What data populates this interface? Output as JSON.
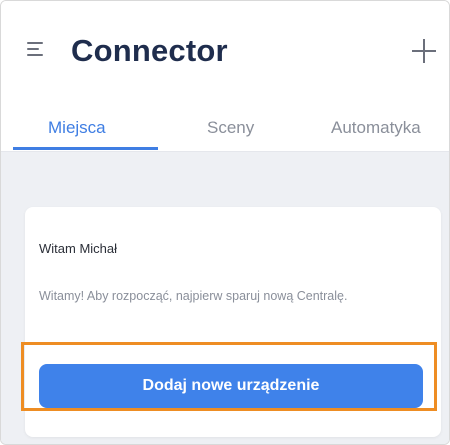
{
  "header": {
    "title": "Connector",
    "menu_icon": "menu-icon",
    "add_icon": "plus-icon"
  },
  "tabs": [
    {
      "label": "Miejsca",
      "active": true
    },
    {
      "label": "Sceny",
      "active": false
    },
    {
      "label": "Automatyka",
      "active": false
    }
  ],
  "card": {
    "greeting": "Witam Michał",
    "message": "Witamy! Aby rozpocząć, najpierw sparuj nową Centralę.",
    "button_label": "Dodaj nowe urządzenie"
  },
  "colors": {
    "accent": "#3f82ea",
    "highlight": "#ee8d23",
    "title": "#1f2d4d",
    "background": "#eef0f4"
  }
}
